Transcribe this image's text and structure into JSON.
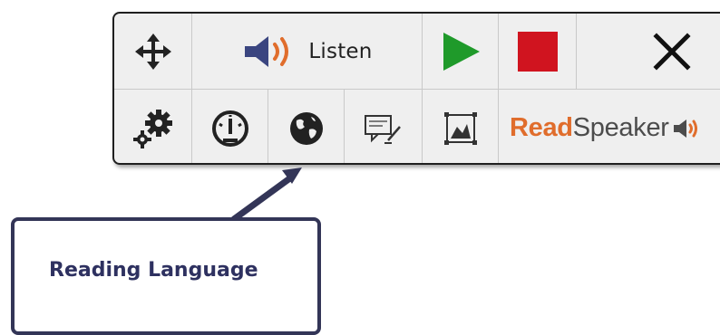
{
  "toolbar": {
    "move_icon": "move-arrows-icon",
    "listen_icon": "speaker-icon",
    "listen_label": "Listen",
    "play_icon": "play-icon",
    "stop_icon": "stop-icon",
    "close_icon": "close-icon",
    "settings_icon": "gear-icon",
    "speed_icon": "speedometer-icon",
    "language_icon": "globe-icon",
    "text_mode_icon": "text-annotation-icon",
    "picture_icon": "image-frame-icon",
    "brand_read": "Read",
    "brand_speaker": "Speaker",
    "brand_icon": "speaker-icon"
  },
  "callout": {
    "text": "Reading Language"
  },
  "colors": {
    "play": "#1f9a2a",
    "stop": "#d0141f",
    "speaker_body": "#3a4580",
    "speaker_waves": "#e06d2c",
    "brand_read": "#e06d2c",
    "callout_border": "#333557",
    "callout_text": "#2e3160"
  }
}
